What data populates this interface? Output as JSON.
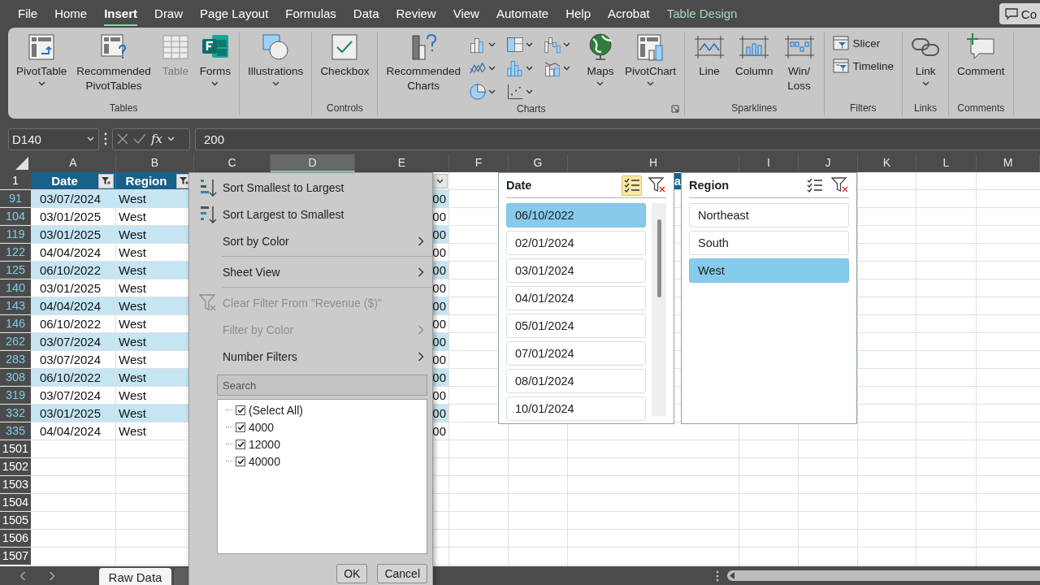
{
  "menu_tabs": [
    {
      "label": "File",
      "selected": false,
      "kind": "normal"
    },
    {
      "label": "Home",
      "selected": false,
      "kind": "normal"
    },
    {
      "label": "Insert",
      "selected": true,
      "kind": "normal"
    },
    {
      "label": "Draw",
      "selected": false,
      "kind": "normal"
    },
    {
      "label": "Page Layout",
      "selected": false,
      "kind": "normal"
    },
    {
      "label": "Formulas",
      "selected": false,
      "kind": "normal"
    },
    {
      "label": "Data",
      "selected": false,
      "kind": "normal"
    },
    {
      "label": "Review",
      "selected": false,
      "kind": "normal"
    },
    {
      "label": "View",
      "selected": false,
      "kind": "normal"
    },
    {
      "label": "Automate",
      "selected": false,
      "kind": "normal"
    },
    {
      "label": "Help",
      "selected": false,
      "kind": "normal"
    },
    {
      "label": "Acrobat",
      "selected": false,
      "kind": "normal"
    },
    {
      "label": "Table Design",
      "selected": false,
      "kind": "contextual"
    }
  ],
  "comments_button": {
    "label": "Co"
  },
  "ribbon": {
    "groups": [
      {
        "label": "Tables",
        "buttons": [
          {
            "kind": "large",
            "label": "PivotTable",
            "caret": true,
            "disabled": false
          },
          {
            "kind": "large",
            "label": "Recommended\nPivotTables",
            "caret": false,
            "disabled": false
          },
          {
            "kind": "large",
            "label": "Table",
            "caret": false,
            "disabled": true
          },
          {
            "kind": "large",
            "label": "Forms",
            "caret": true,
            "disabled": false
          }
        ]
      },
      {
        "buttons": [
          {
            "kind": "large",
            "label": "Illustrations",
            "caret": true,
            "disabled": false
          }
        ]
      },
      {
        "label": "Controls",
        "buttons": [
          {
            "kind": "large",
            "label": "Checkbox",
            "caret": false,
            "disabled": false
          }
        ]
      },
      {
        "label": "Charts",
        "buttons": [
          {
            "kind": "large",
            "label": "Recommended\nCharts",
            "caret": false,
            "disabled": false
          },
          {
            "kind": "icon",
            "caret": true,
            "disabled": false
          },
          {
            "kind": "icon",
            "caret": true,
            "disabled": false
          },
          {
            "kind": "icon",
            "caret": true,
            "disabled": false
          },
          {
            "kind": "icon",
            "caret": true,
            "disabled": false
          },
          {
            "kind": "icon",
            "caret": true,
            "disabled": false
          },
          {
            "kind": "icon",
            "caret": true,
            "disabled": false
          },
          {
            "kind": "icon",
            "caret": true,
            "disabled": false
          },
          {
            "kind": "icon",
            "caret": true,
            "disabled": false
          },
          {
            "kind": "large",
            "label": "Maps",
            "caret": true,
            "disabled": false
          },
          {
            "kind": "large",
            "label": "PivotChart",
            "caret": true,
            "disabled": false
          }
        ]
      },
      {
        "label": "Sparklines",
        "buttons": [
          {
            "kind": "large",
            "label": "Line",
            "caret": false,
            "disabled": false
          },
          {
            "kind": "large",
            "label": "Column",
            "caret": false,
            "disabled": false
          },
          {
            "kind": "large",
            "label": "Win/\nLoss",
            "caret": false,
            "disabled": false
          }
        ]
      },
      {
        "label": "Filters",
        "buttons": [
          {
            "kind": "small",
            "label": "Slicer",
            "caret": false,
            "disabled": false
          },
          {
            "kind": "small",
            "label": "Timeline",
            "caret": false,
            "disabled": false
          }
        ]
      },
      {
        "label": "Links",
        "buttons": [
          {
            "kind": "large",
            "label": "Link",
            "caret": true,
            "disabled": false
          }
        ]
      },
      {
        "label": "Comments",
        "buttons": [
          {
            "kind": "large",
            "label": "Comment",
            "caret": false,
            "disabled": false
          }
        ]
      }
    ]
  },
  "formula_bar": {
    "name_box": "D140",
    "fx": "fx",
    "value": "200"
  },
  "columns": [
    {
      "label": "A",
      "selected": false
    },
    {
      "label": "B",
      "selected": false
    },
    {
      "label": "C",
      "selected": false
    },
    {
      "label": "D",
      "selected": true
    },
    {
      "label": "E",
      "selected": false
    },
    {
      "label": "F",
      "selected": false
    },
    {
      "label": "G",
      "selected": false
    },
    {
      "label": "H",
      "selected": false
    },
    {
      "label": "I",
      "selected": false
    },
    {
      "label": "J",
      "selected": false
    },
    {
      "label": "K",
      "selected": false
    },
    {
      "label": "L",
      "selected": false
    },
    {
      "label": "M",
      "selected": false
    }
  ],
  "header_row": {
    "number": "1",
    "date": "Date",
    "date_filtered": true,
    "region": "Region",
    "region_filtered": true,
    "column_5_filtered": false,
    "column_8": "a"
  },
  "rows": [
    {
      "number": "91",
      "date": "03/07/2024",
      "region": "West",
      "column_5": "00"
    },
    {
      "number": "104",
      "date": "03/01/2025",
      "region": "West",
      "column_5": "00"
    },
    {
      "number": "119",
      "date": "03/01/2025",
      "region": "West",
      "column_5": "00"
    },
    {
      "number": "122",
      "date": "04/04/2024",
      "region": "West",
      "column_5": "00"
    },
    {
      "number": "125",
      "date": "06/10/2022",
      "region": "West",
      "column_5": "00"
    },
    {
      "number": "140",
      "date": "03/01/2025",
      "region": "West",
      "column_5": "00"
    },
    {
      "number": "143",
      "date": "04/04/2024",
      "region": "West",
      "column_5": "00"
    },
    {
      "number": "146",
      "date": "06/10/2022",
      "region": "West",
      "column_5": "00"
    },
    {
      "number": "262",
      "date": "03/07/2024",
      "region": "West",
      "column_5": "00"
    },
    {
      "number": "283",
      "date": "03/07/2024",
      "region": "West",
      "column_5": "00"
    },
    {
      "number": "308",
      "date": "06/10/2022",
      "region": "West",
      "column_5": "00"
    },
    {
      "number": "319",
      "date": "03/07/2024",
      "region": "West",
      "column_5": "00"
    },
    {
      "number": "332",
      "date": "03/01/2025",
      "region": "West",
      "column_5": "00"
    },
    {
      "number": "335",
      "date": "04/04/2024",
      "region": "West",
      "column_5": "00"
    }
  ],
  "empty_rows": [
    "1501",
    "1502",
    "1503",
    "1504",
    "1505",
    "1506",
    "1507"
  ],
  "filter_menu": {
    "items": [
      {
        "kind": "item",
        "label": "Sort Smallest to Largest",
        "submenu": false,
        "disabled": false
      },
      {
        "kind": "item",
        "label": "Sort Largest to Smallest",
        "submenu": false,
        "disabled": false
      },
      {
        "kind": "item",
        "label": "Sort by Color",
        "submenu": true,
        "disabled": false
      },
      {
        "kind": "divider"
      },
      {
        "kind": "item",
        "label": "Sheet View",
        "submenu": true,
        "disabled": false
      },
      {
        "kind": "divider"
      },
      {
        "kind": "item",
        "label": "Clear Filter From \"Revenue ($)\"",
        "submenu": false,
        "disabled": true
      },
      {
        "kind": "item",
        "label": "Filter by Color",
        "submenu": true,
        "disabled": true
      },
      {
        "kind": "item",
        "label": "Number Filters",
        "submenu": true,
        "disabled": false
      }
    ],
    "search": {
      "placeholder": "Search"
    },
    "values": [
      {
        "label": "(Select All)",
        "checked": true
      },
      {
        "label": "4000",
        "checked": true
      },
      {
        "label": "12000",
        "checked": true
      },
      {
        "label": "40000",
        "checked": true
      }
    ],
    "buttons": [
      "OK",
      "Cancel"
    ]
  },
  "slicers": [
    {
      "title": "Date",
      "multi_select": true,
      "items": [
        {
          "label": "06/10/2022",
          "selected": true
        },
        {
          "label": "02/01/2024",
          "selected": false
        },
        {
          "label": "03/01/2024",
          "selected": false
        },
        {
          "label": "04/01/2024",
          "selected": false
        },
        {
          "label": "05/01/2024",
          "selected": false
        },
        {
          "label": "07/01/2024",
          "selected": false
        },
        {
          "label": "08/01/2024",
          "selected": false
        },
        {
          "label": "10/01/2024",
          "selected": false
        }
      ]
    },
    {
      "title": "Region",
      "multi_select": false,
      "items": [
        {
          "label": "Northeast",
          "selected": false
        },
        {
          "label": "South",
          "selected": false
        },
        {
          "label": "West",
          "selected": true
        }
      ]
    }
  ],
  "sheet_tabs": [
    {
      "label": "Raw Data",
      "selected": true
    }
  ]
}
